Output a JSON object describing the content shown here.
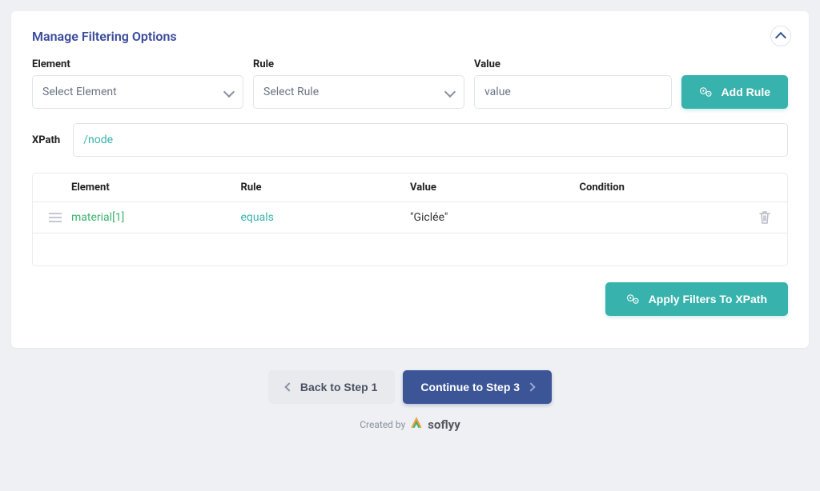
{
  "card": {
    "title": "Manage Filtering Options"
  },
  "controls": {
    "element_label": "Element",
    "element_placeholder": "Select Element",
    "rule_label": "Rule",
    "rule_placeholder": "Select Rule",
    "value_label": "Value",
    "value_placeholder": "value",
    "add_rule_label": "Add Rule"
  },
  "xpath": {
    "label": "XPath",
    "value": "/node"
  },
  "table": {
    "head_element": "Element",
    "head_rule": "Rule",
    "head_value": "Value",
    "head_condition": "Condition",
    "rows": [
      {
        "element": "material[1]",
        "rule": "equals",
        "value": "\"Giclée\"",
        "condition": ""
      }
    ]
  },
  "apply_label": "Apply Filters To XPath",
  "footer": {
    "back_label": "Back to Step 1",
    "continue_label": "Continue to Step 3",
    "created_by": "Created by",
    "brand": "soflyy"
  }
}
